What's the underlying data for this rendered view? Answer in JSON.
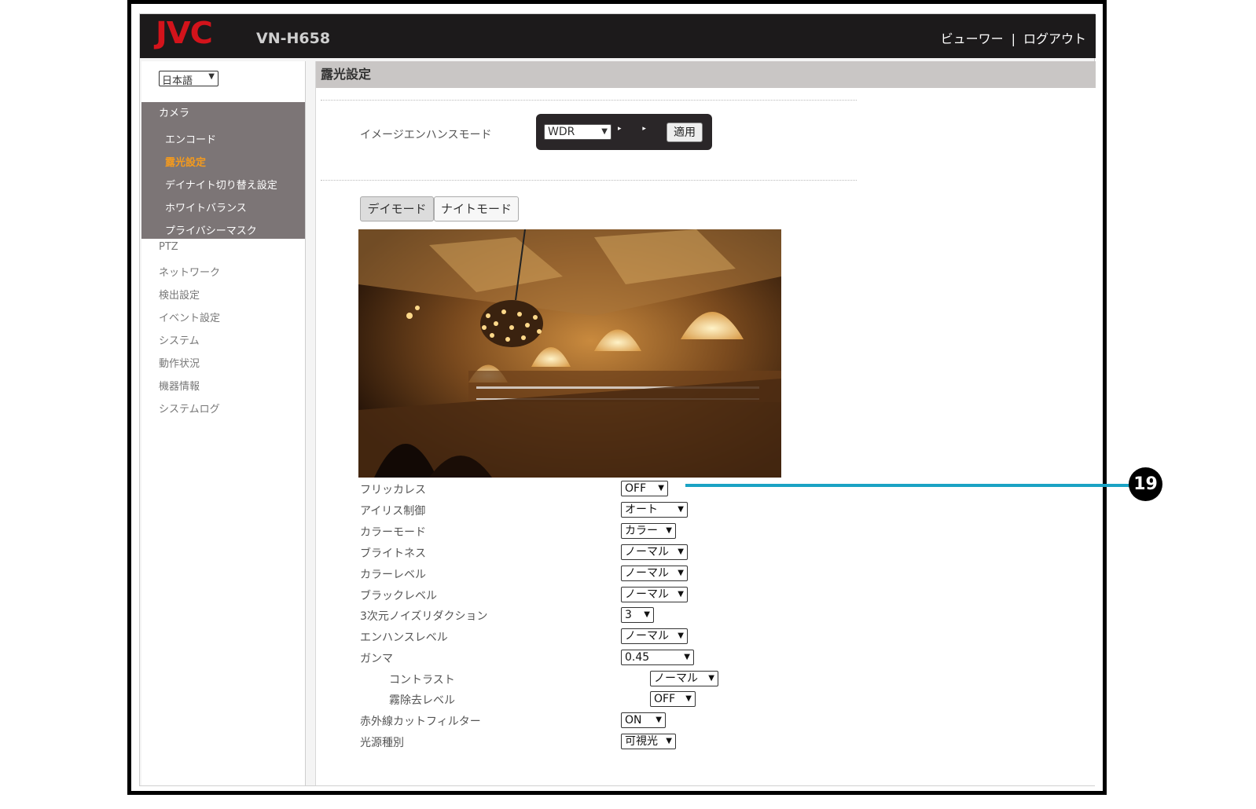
{
  "header": {
    "logo": "JVC",
    "model": "VN-H658",
    "viewer_link": "ビューワー",
    "separator": "|",
    "logout_link": "ログアウト",
    "logo_color": "#d3131b"
  },
  "sidebar": {
    "language": "日本語",
    "camera_group": "カメラ",
    "camera_items": [
      "エンコード",
      "露光設定",
      "デイナイト切り替え設定",
      "ホワイトバランス",
      "プライバシーマスク"
    ],
    "active_item": "露光設定",
    "nav_items": [
      "PTZ",
      "ネットワーク",
      "検出設定",
      "イベント設定",
      "システム",
      "動作状況",
      "機器情報",
      "システムログ"
    ]
  },
  "main": {
    "title": "露光設定",
    "image_enhance_label": "イメージエンハンスモード",
    "image_enhance_value": "WDR",
    "arrow_glyphs": "▸ ▸ ▸",
    "apply_button": "適用",
    "tabs": [
      "デイモード",
      "ナイトモード"
    ],
    "active_tab": "デイモード",
    "preview_image": "camera-preview: ornate hall interior with chandelier",
    "settings": [
      {
        "label": "フリッカレス",
        "value": "OFF",
        "indent": false
      },
      {
        "label": "アイリス制御",
        "value": "オート",
        "indent": false
      },
      {
        "label": "カラーモード",
        "value": "カラー",
        "indent": false
      },
      {
        "label": "ブライトネス",
        "value": "ノーマル",
        "indent": false
      },
      {
        "label": "カラーレベル",
        "value": "ノーマル",
        "indent": false
      },
      {
        "label": "ブラックレベル",
        "value": "ノーマル",
        "indent": false
      },
      {
        "label": "3次元ノイズリダクション",
        "value": "3",
        "indent": false
      },
      {
        "label": "エンハンスレベル",
        "value": "ノーマル",
        "indent": false
      },
      {
        "label": "ガンマ",
        "value": "0.45",
        "indent": false
      },
      {
        "label": "コントラスト",
        "value": "ノーマル",
        "indent": true
      },
      {
        "label": "霧除去レベル",
        "value": "OFF",
        "indent": true
      },
      {
        "label": "赤外線カットフィルター",
        "value": "ON",
        "indent": false
      },
      {
        "label": "光源種別",
        "value": "可視光",
        "indent": false
      }
    ]
  },
  "callout": {
    "number": "19",
    "color": "#1aa3c4"
  }
}
